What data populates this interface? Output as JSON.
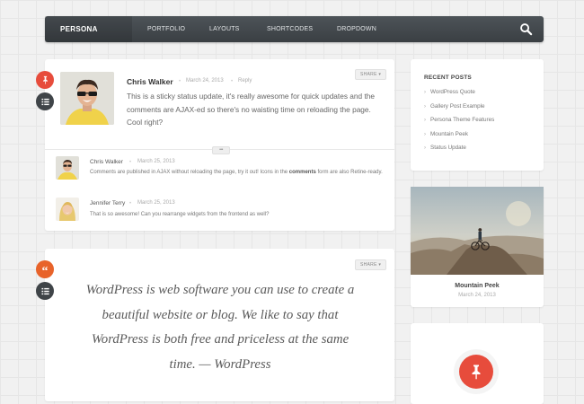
{
  "nav": {
    "brand": "PERSONA",
    "items": [
      "PORTFOLIO",
      "LAYOUTS",
      "SHORTCODES",
      "DROPDOWN"
    ]
  },
  "status_post": {
    "author": "Chris Walker",
    "date": "March 24, 2013",
    "reply_label": "Reply",
    "share_label": "SHARE ▾",
    "body": "This is a sticky status update, it's really awesome for quick updates and the comments are AJAX-ed so there's no waisting time on reloading the page. Cool right?",
    "more_label": "•••",
    "comments": [
      {
        "author": "Chris Walker",
        "date": "March 25, 2013",
        "text_before": "Comments are published in AJAX without reloading the page, try it out! Icons in the ",
        "text_bold": "comments",
        "text_after": " form are also Retine-ready."
      },
      {
        "author": "Jennifer Terry",
        "date": "March 25, 2013",
        "text": "That is so awesome! Can you rearrange widgets from the frontend as well?"
      }
    ]
  },
  "quote_post": {
    "share_label": "SHARE ▾",
    "text": "WordPress is web software you can use to create a beautiful website or blog. We like to say that WordPress is both free and priceless at the same time. — WordPress"
  },
  "sidebar": {
    "recent_title": "RECENT POSTS",
    "recent_posts": [
      "WordPress Quote",
      "Gallery Post Example",
      "Persona Theme Features",
      "Mountain Peek",
      "Status Update"
    ],
    "feature": {
      "title": "Mountain Peek",
      "date": "March 24, 2013"
    }
  },
  "colors": {
    "pin": "#e74c3c",
    "quote": "#e8632a",
    "menu": "#3f4448",
    "nav": "#43494d"
  }
}
